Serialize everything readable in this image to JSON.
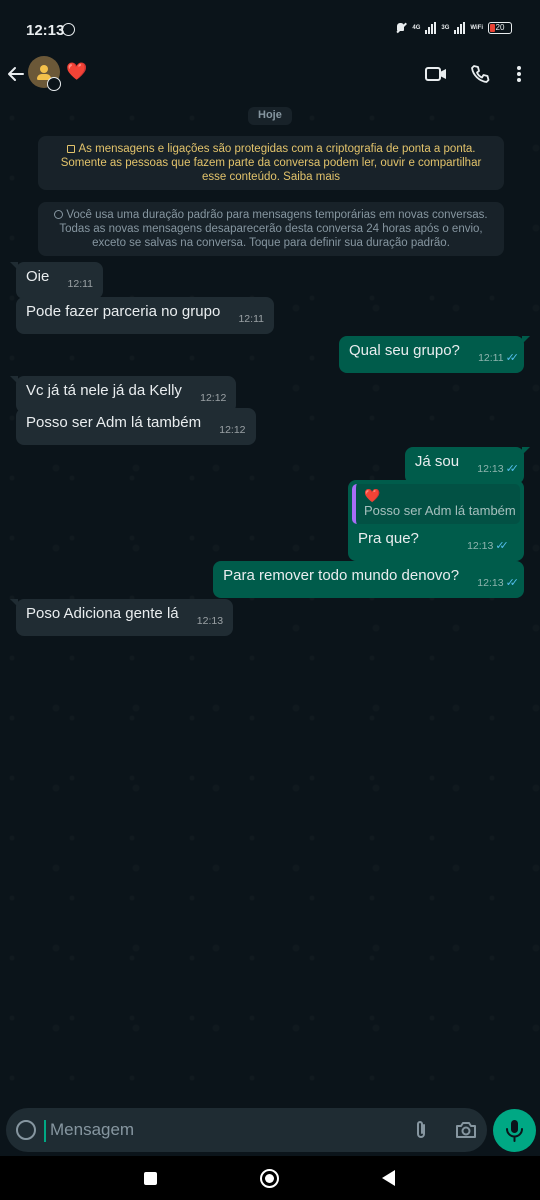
{
  "status": {
    "time": "12:13",
    "net1": "4G",
    "net2": "3G",
    "wifi": "WiFi",
    "battery": "20"
  },
  "header": {
    "contact_name": "❤️"
  },
  "chat": {
    "date_label": "Hoje",
    "encryption_notice": "As mensagens e ligações são protegidas com a criptografia de ponta a ponta. Somente as pessoas que fazem parte da conversa podem ler, ouvir e compartilhar esse conteúdo. Saiba mais",
    "disappearing_notice": "Você usa uma duração padrão para mensagens temporárias em novas conversas. Todas as novas mensagens desaparecerão desta conversa 24 horas após o envio, exceto se salvas na conversa. Toque para definir sua duração padrão.",
    "messages": [
      {
        "dir": "in",
        "text": "Oie",
        "time": "12:11"
      },
      {
        "dir": "in",
        "text": "Pode fazer parceria no grupo",
        "time": "12:11"
      },
      {
        "dir": "out",
        "text": "Qual seu grupo?",
        "time": "12:11"
      },
      {
        "dir": "in",
        "text": "Vc já tá nele já da Kelly",
        "time": "12:12"
      },
      {
        "dir": "in",
        "text": "Posso ser Adm lá também",
        "time": "12:12"
      },
      {
        "dir": "out",
        "text": "Já sou",
        "time": "12:13"
      },
      {
        "dir": "out",
        "text": "Pra que?",
        "time": "12:13",
        "reply_to": {
          "author": "❤️",
          "text": "Posso ser Adm lá também"
        }
      },
      {
        "dir": "out",
        "text": "Para remover todo mundo denovo?",
        "time": "12:13"
      },
      {
        "dir": "in",
        "text": "Poso Adiciona gente lá",
        "time": "12:13"
      }
    ]
  },
  "composer": {
    "placeholder": "Mensagem"
  },
  "icons": {
    "back": "arrow-left-icon",
    "video": "video-call-icon",
    "call": "phone-icon",
    "menu": "more-vert-icon",
    "emoji": "sticker-emoji-icon",
    "attach": "paperclip-icon",
    "camera": "camera-icon",
    "mic": "microphone-icon"
  },
  "colors": {
    "accent": "#00a884",
    "outgoing": "#005c4b",
    "incoming": "#202c33",
    "read_ticks": "#53bdeb",
    "background": "#0b141a"
  }
}
